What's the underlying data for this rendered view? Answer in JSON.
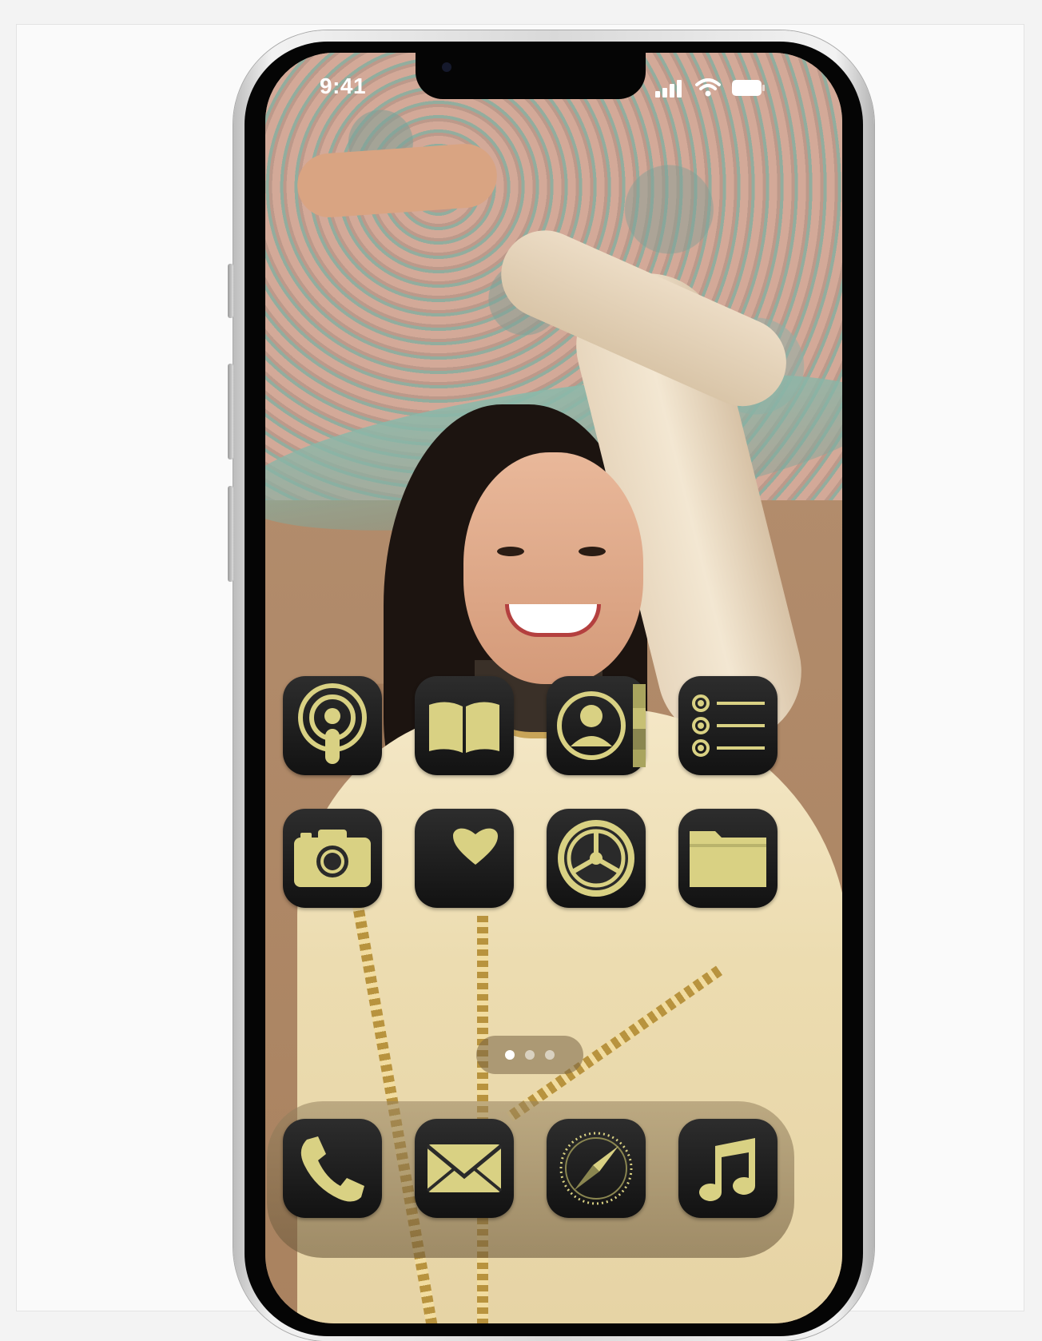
{
  "status_bar": {
    "time": "9:41"
  },
  "home_screen": {
    "apps": [
      {
        "name": "podcasts-icon"
      },
      {
        "name": "books-icon"
      },
      {
        "name": "contacts-icon"
      },
      {
        "name": "reminders-icon"
      },
      {
        "name": "camera-icon"
      },
      {
        "name": "health-icon"
      },
      {
        "name": "settings-icon"
      },
      {
        "name": "files-icon"
      }
    ],
    "page_indicator": {
      "pages": 3,
      "current": 1
    }
  },
  "dock": {
    "apps": [
      {
        "name": "phone-icon"
      },
      {
        "name": "mail-icon"
      },
      {
        "name": "safari-icon"
      },
      {
        "name": "music-icon"
      }
    ]
  },
  "colors": {
    "icon_gold": "#d9d183",
    "icon_dark": "#141414"
  }
}
